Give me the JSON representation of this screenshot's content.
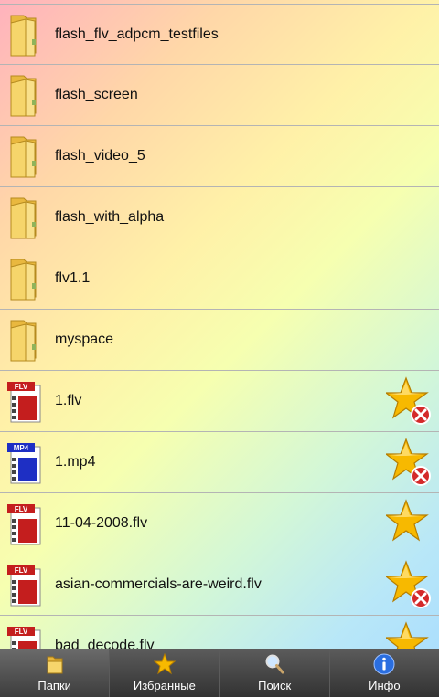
{
  "files": [
    {
      "name": "flash_flv_adpcm_testfiles",
      "type": "folder",
      "favorite": null
    },
    {
      "name": "flash_screen",
      "type": "folder",
      "favorite": null
    },
    {
      "name": "flash_video_5",
      "type": "folder",
      "favorite": null
    },
    {
      "name": "flash_with_alpha",
      "type": "folder",
      "favorite": null
    },
    {
      "name": "flv1.1",
      "type": "folder",
      "favorite": null
    },
    {
      "name": "myspace",
      "type": "folder",
      "favorite": null
    },
    {
      "name": "1.flv",
      "type": "flv",
      "favorite": "remove"
    },
    {
      "name": "1.mp4",
      "type": "mp4",
      "favorite": "remove"
    },
    {
      "name": "11-04-2008.flv",
      "type": "flv",
      "favorite": "add"
    },
    {
      "name": "asian-commercials-are-weird.flv",
      "type": "flv",
      "favorite": "remove"
    },
    {
      "name": "bad_decode.flv",
      "type": "flv",
      "favorite": "add"
    }
  ],
  "icon_labels": {
    "flv": "FLV",
    "mp4": "MP4"
  },
  "tabs": [
    {
      "label": "Папки",
      "icon": "folder-icon"
    },
    {
      "label": "Избранные",
      "icon": "star-icon"
    },
    {
      "label": "Поиск",
      "icon": "search-icon"
    },
    {
      "label": "Инфо",
      "icon": "info-icon"
    }
  ],
  "colors": {
    "flv": "#c41e1e",
    "mp4": "#1e2fc4",
    "folder": "#f2c84b",
    "star": "#f7b900",
    "remove": "#d42a2a"
  }
}
